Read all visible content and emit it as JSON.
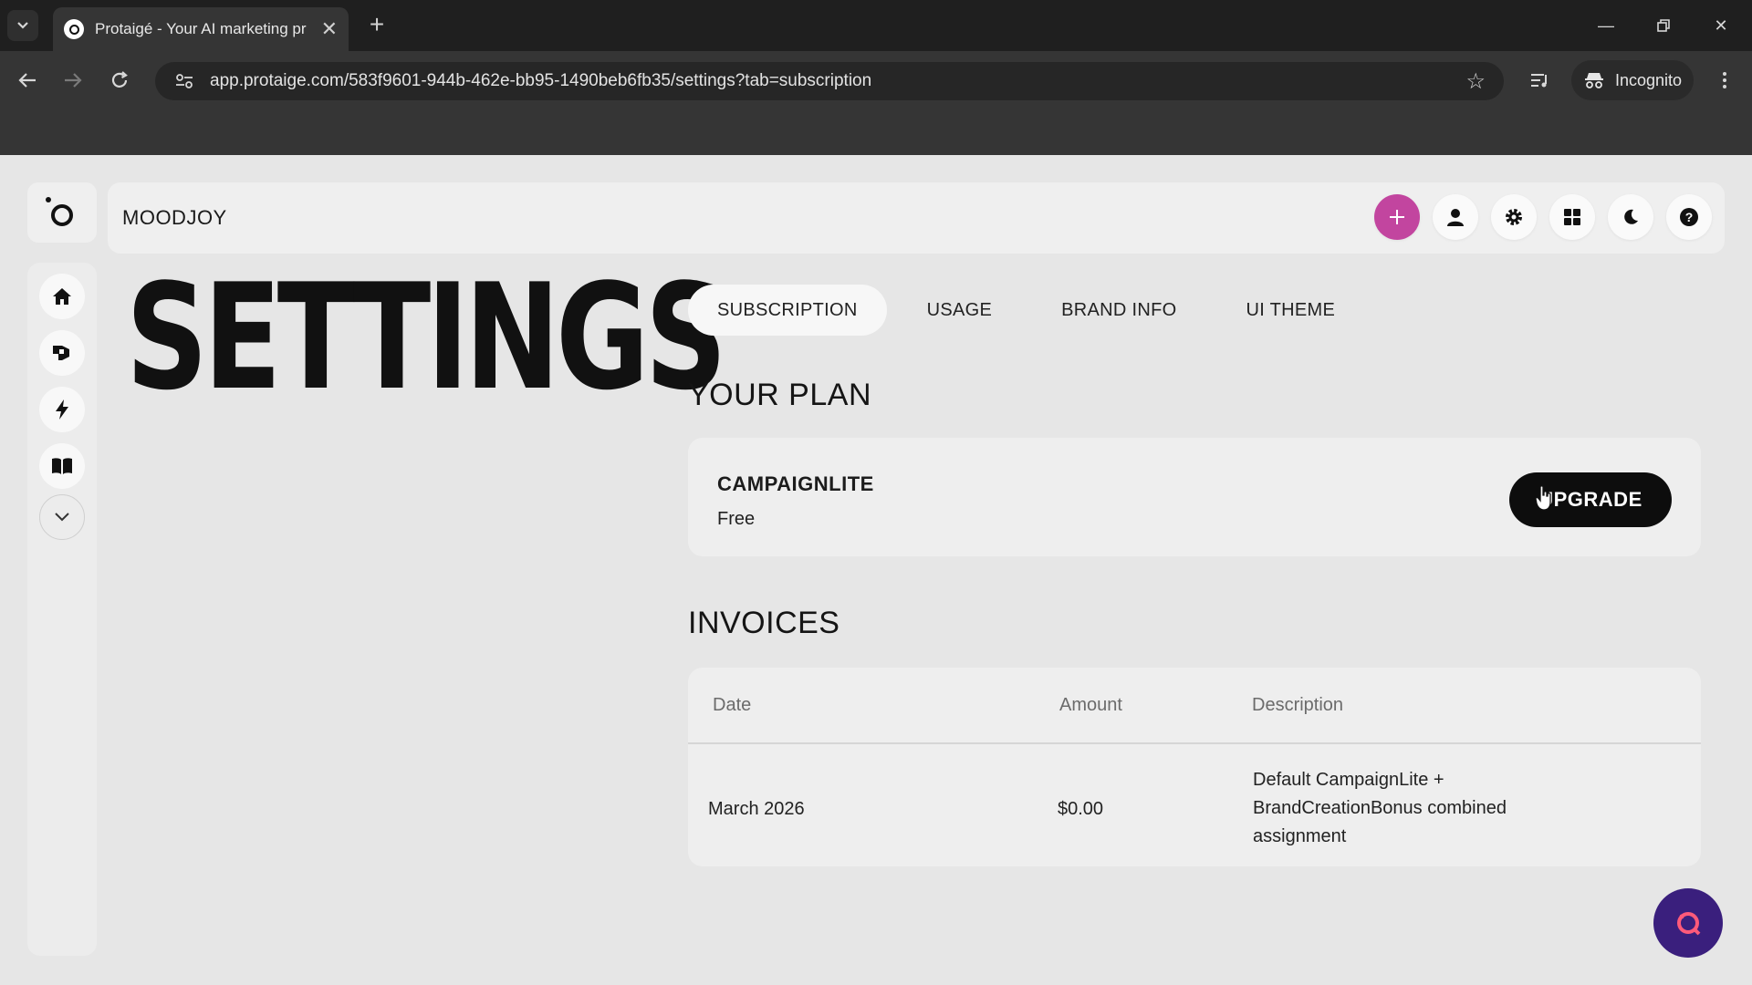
{
  "browser": {
    "tab_title": "Protaigé - Your AI marketing pr",
    "url": "app.protaige.com/583f9601-944b-462e-bb95-1490beb6fb35/settings?tab=subscription",
    "incognito_label": "Incognito"
  },
  "app": {
    "brand_name": "MOODJOY",
    "accent_color": "#c2459f",
    "chat_color": "#3a1f7d"
  },
  "page": {
    "title": "SETTINGS"
  },
  "tabs": [
    {
      "label": "SUBSCRIPTION",
      "active": true
    },
    {
      "label": "USAGE",
      "active": false
    },
    {
      "label": "BRAND INFO",
      "active": false
    },
    {
      "label": "UI THEME",
      "active": false
    }
  ],
  "plan": {
    "heading": "YOUR PLAN",
    "name": "CAMPAIGNLITE",
    "price": "Free",
    "upgrade_label": "UPGRADE"
  },
  "invoices": {
    "heading": "INVOICES",
    "columns": [
      "Date",
      "Amount",
      "Description"
    ],
    "rows": [
      {
        "date": "March 2026",
        "amount": "$0.00",
        "description": "Default CampaignLite + BrandCreationBonus combined assignment"
      }
    ]
  }
}
